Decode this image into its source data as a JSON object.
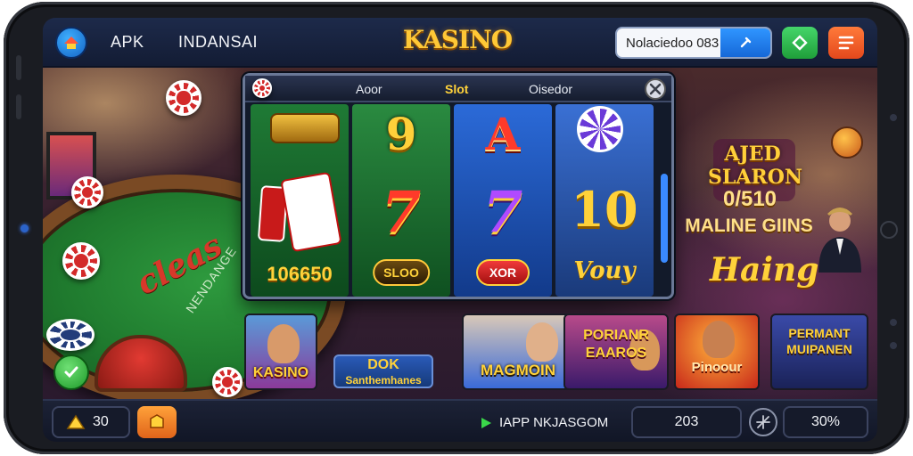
{
  "header": {
    "nav": [
      "APK",
      "INDANSAI"
    ],
    "brand": "KASINO",
    "search_value": "Nolaciedoo 083"
  },
  "slot": {
    "tabs": [
      "Aoor",
      "Slot",
      "Oisedor"
    ],
    "active_tab": "Slot",
    "reels": [
      {
        "bottom": "106650"
      },
      {
        "top": "9",
        "middle": "7",
        "bottom": "SLOO"
      },
      {
        "top": "A",
        "middle": "7",
        "bottom": "XOR"
      },
      {
        "middle": "10",
        "bottom": "Vouy"
      }
    ]
  },
  "table": {
    "script": "cleas",
    "sub": "NENDANGE"
  },
  "banner": {
    "badge": [
      "AJED",
      "SLARON"
    ],
    "line1": "0/510",
    "line2": "MALINE GIINS",
    "script": "Haing"
  },
  "tiles": [
    {
      "lines": [
        "KASINO"
      ]
    },
    {
      "lines": [
        "DOK",
        "Santhemhanes"
      ]
    },
    {
      "lines": [
        "MAGMOIN"
      ]
    },
    {
      "lines": [
        "PORIANR",
        "EAAROS"
      ]
    },
    {
      "lines": [
        "Pinoour"
      ]
    },
    {
      "lines": [
        "PERMANT",
        "MUIPANEN"
      ]
    }
  ],
  "footer": {
    "left_value": "30",
    "app_label": "IAPP NKJASGOM",
    "mid_value": "203",
    "right_value": "30%"
  },
  "icons": {
    "logo": "home-icon",
    "search": "search-icon",
    "green": "refresh-icon",
    "orange": "menu-icon",
    "close": "close-icon",
    "check": "check-icon",
    "warn": "warning-icon",
    "shop": "shop-icon",
    "play": "play-icon",
    "target": "target-icon"
  },
  "colors": {
    "accent_gold": "#ffd23a",
    "topbar": "#1d2a4a",
    "search_btn": "#1668d8",
    "green_btn": "#1f9f3a",
    "orange_btn": "#e4481c"
  }
}
